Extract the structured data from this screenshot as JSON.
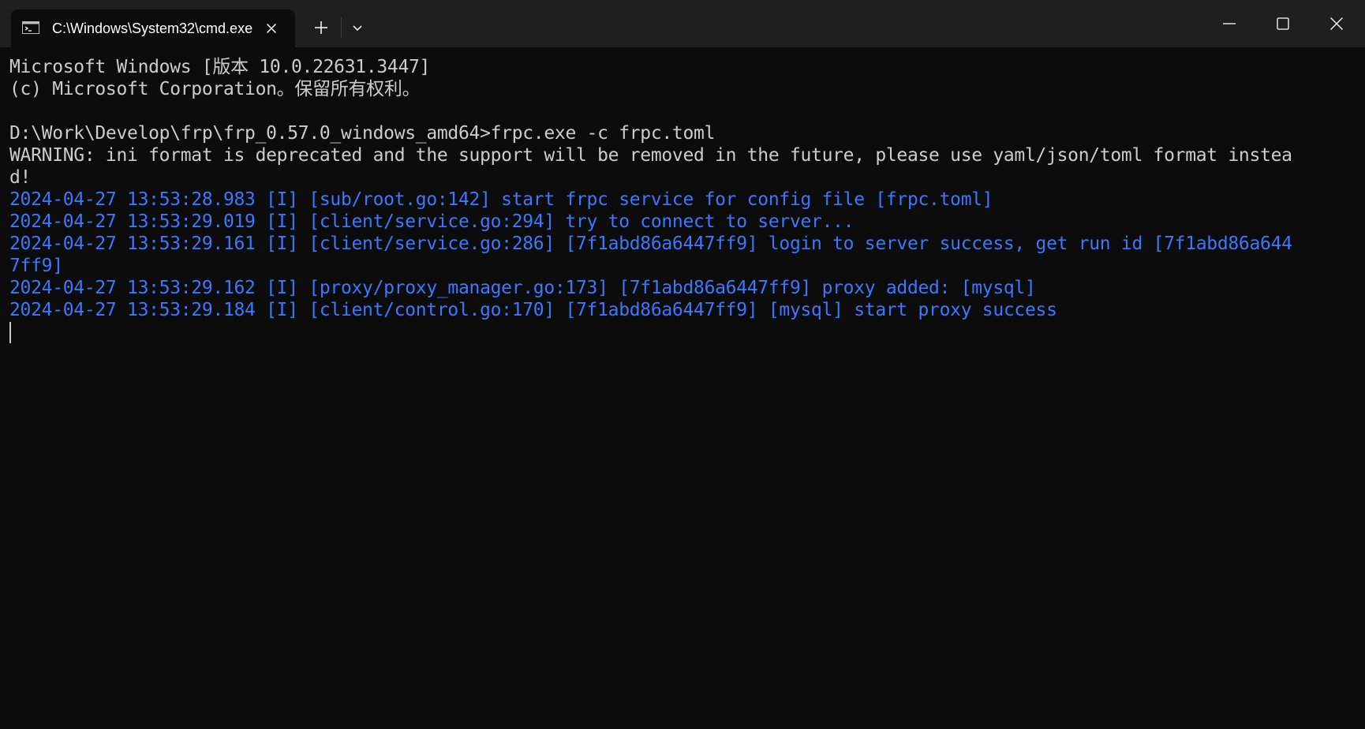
{
  "window": {
    "tab_title": "C:\\Windows\\System32\\cmd.exe",
    "icons": {
      "tab_icon": "cmd-prompt-icon",
      "tab_close": "close-icon",
      "new_tab": "plus-icon",
      "tab_dropdown": "chevron-down-icon",
      "minimize": "minimize-icon",
      "maximize": "maximize-icon",
      "close": "close-icon"
    }
  },
  "colors": {
    "background": "#0c0c0c",
    "titlebar": "#1f1f1f",
    "default_text": "#cccccc",
    "info_text": "#3b78ff"
  },
  "terminal": {
    "lines": [
      "Microsoft Windows [版本 10.0.22631.3447]",
      "(c) Microsoft Corporation。保留所有权利。",
      "",
      "D:\\Work\\Develop\\frp\\frp_0.57.0_windows_amd64>frpc.exe -c frpc.toml",
      "WARNING: ini format is deprecated and the support will be removed in the future, please use yaml/json/toml format instea",
      "d!",
      "2024-04-27 13:53:28.983 [I] [sub/root.go:142] start frpc service for config file [frpc.toml]",
      "2024-04-27 13:53:29.019 [I] [client/service.go:294] try to connect to server...",
      "2024-04-27 13:53:29.161 [I] [client/service.go:286] [7f1abd86a6447ff9] login to server success, get run id [7f1abd86a644",
      "7ff9]",
      "2024-04-27 13:53:29.162 [I] [proxy/proxy_manager.go:173] [7f1abd86a6447ff9] proxy added: [mysql]",
      "2024-04-27 13:53:29.184 [I] [client/control.go:170] [7f1abd86a6447ff9] [mysql] start proxy success"
    ]
  }
}
